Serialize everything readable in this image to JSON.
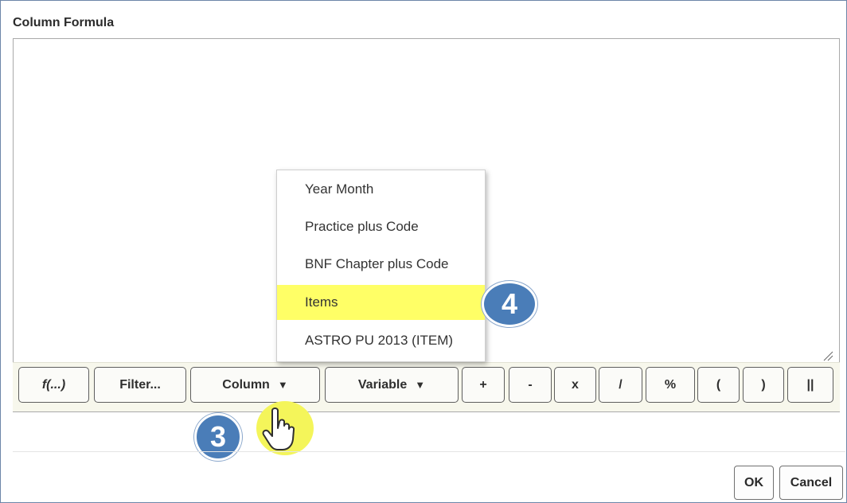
{
  "dialog": {
    "title": "Column Formula"
  },
  "formula": {
    "value": ""
  },
  "toolbar": {
    "function_label": "f(...)",
    "filter_label": "Filter...",
    "column_label": "Column",
    "variable_label": "Variable",
    "dropdown_arrow": "▼",
    "operators": [
      "+",
      "-",
      "x",
      "/",
      "%",
      "(",
      ")",
      "||"
    ]
  },
  "column_menu": {
    "items": [
      "Year Month",
      "Practice plus Code",
      "BNF Chapter plus Code",
      "Items",
      "ASTRO PU 2013 (ITEM)"
    ],
    "highlighted": "Items"
  },
  "callouts": {
    "step3": "3",
    "step4": "4"
  },
  "footer": {
    "ok_label": "OK",
    "cancel_label": "Cancel"
  },
  "colors": {
    "highlight": "#ffff66",
    "badge": "#4a7db8",
    "cursor_glow": "#f4f55a"
  },
  "icons": {
    "cursor": "pointing-hand-cursor-icon",
    "resize": "resize-grip-icon"
  }
}
